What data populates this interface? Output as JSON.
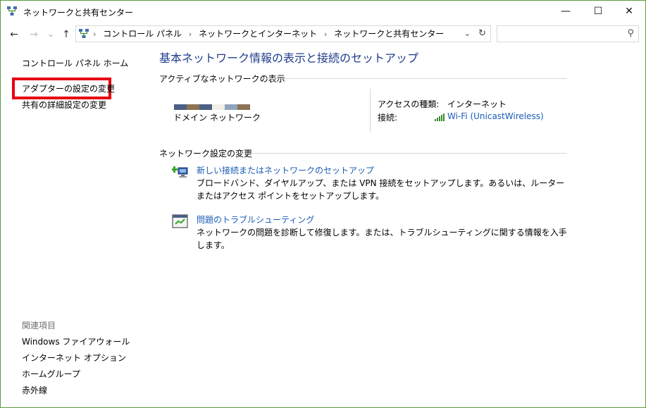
{
  "window": {
    "title": "ネットワークと共有センター",
    "minimize": "—",
    "maximize": "☐",
    "close": "✕"
  },
  "nav": {
    "back": "←",
    "forward": "→",
    "recent": "⌄",
    "up": "↑"
  },
  "address": {
    "crumbs": [
      "コントロール パネル",
      "ネットワークとインターネット",
      "ネットワークと共有センター"
    ],
    "separator": "›",
    "dropdown": "⌄",
    "refresh": "↻"
  },
  "search": {
    "placeholder": "",
    "icon": "⚲"
  },
  "sidebar": {
    "home": "コントロール パネル ホーム",
    "adapter": "アダプターの設定の変更",
    "sharing": "共有の詳細設定の変更",
    "see_also": "関連項目",
    "links": [
      "Windows ファイアウォール",
      "インターネット オプション",
      "ホームグループ",
      "赤外線"
    ]
  },
  "main": {
    "title": "基本ネットワーク情報の表示と接続のセットアップ",
    "active_header": "アクティブなネットワークの表示",
    "network_name": "ドメイン ネットワーク",
    "access_type_label": "アクセスの種類:",
    "access_type_value": "インターネット",
    "connection_label": "接続:",
    "connection_value": "Wi-Fi (UnicastWireless)",
    "change_header": "ネットワーク設定の変更",
    "new_conn_title": "新しい接続またはネットワークのセットアップ",
    "new_conn_desc": "ブロードバンド、ダイヤルアップ、または VPN 接続をセットアップします。あるいは、ルーターまたはアクセス ポイントをセットアップします。",
    "trouble_title": "問題のトラブルシューティング",
    "trouble_desc": "ネットワークの問題を診断して修復します。または、トラブルシューティングに関する情報を入手します。"
  },
  "colors": {
    "highlight_border": "#e60012",
    "link": "#1a5bb6",
    "title": "#1e3c8c",
    "swatches": [
      "#4b6084",
      "#8c7254",
      "#4b6084",
      "#f2f0e6",
      "#8fa4bd",
      "#8c7254"
    ]
  }
}
